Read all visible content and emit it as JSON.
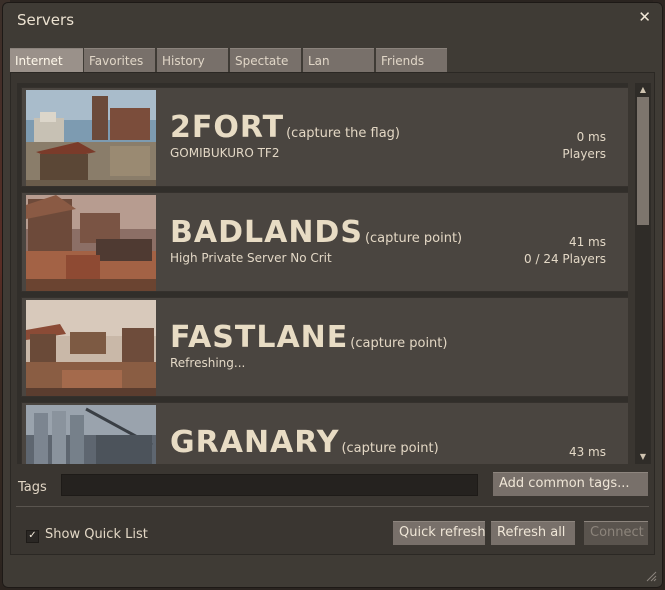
{
  "window": {
    "title": "Servers",
    "close_glyph": "✕"
  },
  "tabs": [
    "Internet",
    "Favorites",
    "History",
    "Spectate",
    "Lan",
    "Friends"
  ],
  "servers": [
    {
      "map": "2FORT",
      "mode": "(capture the flag)",
      "name": "GOMIBUKURO TF2",
      "ping": "0 ms",
      "players": "Players",
      "thumb": "2fort-thumbnail"
    },
    {
      "map": "BADLANDS",
      "mode": "(capture point)",
      "name": "High Private Server No Crit",
      "ping": "41 ms",
      "players": "0 / 24 Players",
      "thumb": "badlands-thumbnail"
    },
    {
      "map": "FASTLANE",
      "mode": "(capture point)",
      "name": "Refreshing...",
      "ping": "",
      "players": "",
      "thumb": "fastlane-thumbnail"
    },
    {
      "map": "GRANARY",
      "mode": "(capture point)",
      "name": "",
      "ping": "43 ms",
      "players": "",
      "thumb": "granary-thumbnail"
    }
  ],
  "tags": {
    "label": "Tags",
    "value": "",
    "add_button": "Add common tags..."
  },
  "footer": {
    "quick_list_label": "Show Quick List",
    "quick_list_checked": true,
    "check_glyph": "✓",
    "quick_refresh": "Quick refresh",
    "refresh_all": "Refresh all",
    "connect": "Connect"
  },
  "scrollbar": {
    "up_glyph": "▲",
    "down_glyph": "▼"
  }
}
